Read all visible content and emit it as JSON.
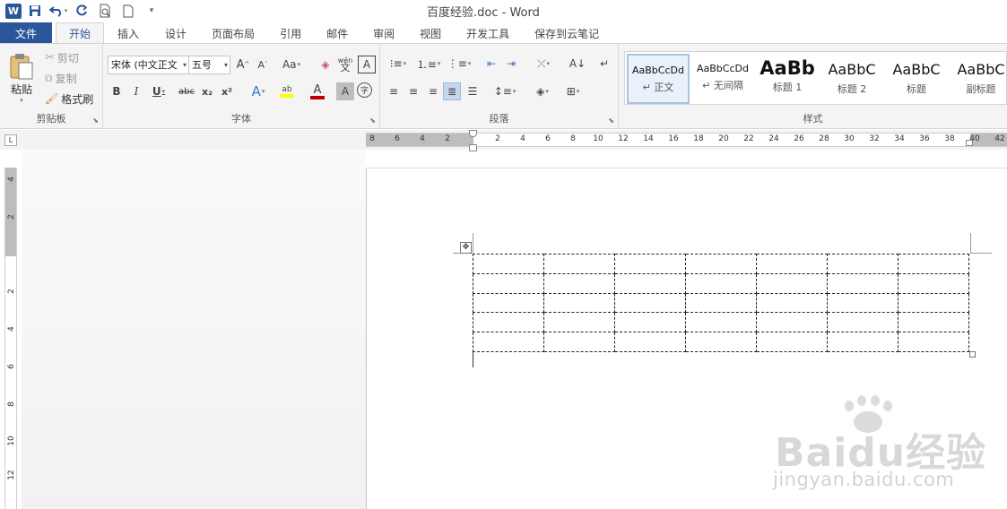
{
  "app": {
    "window_title": "百度经验.doc - Word",
    "qat_icons": [
      "word-logo",
      "save-icon",
      "undo-icon",
      "redo-icon",
      "print-preview-icon",
      "new-doc-icon",
      "customize-qat-icon"
    ]
  },
  "tabs": [
    {
      "label": "文件"
    },
    {
      "label": "开始"
    },
    {
      "label": "插入"
    },
    {
      "label": "设计"
    },
    {
      "label": "页面布局"
    },
    {
      "label": "引用"
    },
    {
      "label": "邮件"
    },
    {
      "label": "审阅"
    },
    {
      "label": "视图"
    },
    {
      "label": "开发工具"
    },
    {
      "label": "保存到云笔记"
    }
  ],
  "clipboard": {
    "paste": "粘贴",
    "cut": "剪切",
    "copy": "复制",
    "format_painter": "格式刷",
    "label": "剪贴板"
  },
  "font": {
    "name": "宋体 (中文正文",
    "size": "五号",
    "label": "字体",
    "grow": "A",
    "shrink": "A",
    "change_case": "Aa",
    "bold": "B",
    "italic": "I",
    "underline": "U",
    "strike": "abc",
    "subscript": "x₂",
    "superscript": "x²",
    "phonetic": "wén",
    "char_border": "A",
    "text_effect": "A",
    "highlight": "ab",
    "font_color": "A",
    "shading": "A",
    "enclose": "字"
  },
  "paragraph": {
    "label": "段落"
  },
  "styles": {
    "label": "样式",
    "items": [
      {
        "sample": "AaBbCcDd",
        "name": "↵ 正文"
      },
      {
        "sample": "AaBbCcDd",
        "name": "↵ 无间隔"
      },
      {
        "sample": "AaBb",
        "name": "标题 1"
      },
      {
        "sample": "AaBbC",
        "name": "标题 2"
      },
      {
        "sample": "AaBbC",
        "name": "标题"
      },
      {
        "sample": "AaBbC",
        "name": "副标题"
      }
    ]
  },
  "ruler": {
    "tab_selector": "L",
    "h_numbers": [
      "8",
      "6",
      "4",
      "2",
      "2",
      "4",
      "6",
      "8",
      "10",
      "12",
      "14",
      "16",
      "18",
      "20",
      "22",
      "24",
      "26",
      "28",
      "30",
      "32",
      "34",
      "36",
      "38",
      "40",
      "42"
    ],
    "v_numbers": [
      "4",
      "2",
      "2",
      "4",
      "6",
      "8",
      "10",
      "12"
    ]
  },
  "table": {
    "rows": 5,
    "cols": 7,
    "move_handle": "✥"
  },
  "watermark": {
    "logo_text": "Baidu经验",
    "url": "jingyan.baidu.com"
  },
  "colors": {
    "accent": "#2b579a",
    "ribbon_bg": "#f4f4f4",
    "ruler_margin": "#bdbdbd"
  }
}
